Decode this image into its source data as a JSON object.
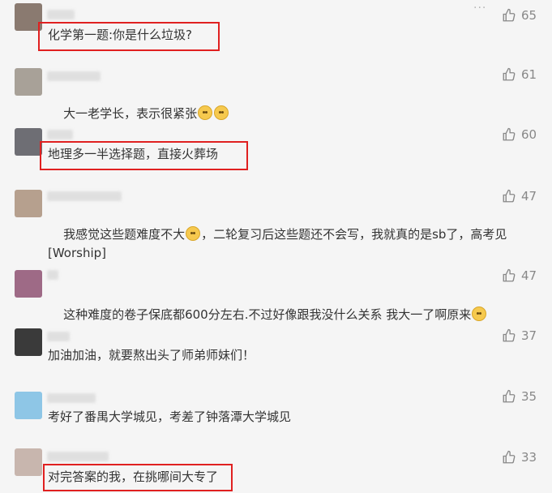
{
  "comments": [
    {
      "text": "化学第一题:你是什么垃圾?",
      "likes": "65",
      "highlighted": true,
      "avatar_color": "#8a7a70"
    },
    {
      "text": "大一老学长，表示很紧张",
      "emoji": "worried-face-icon",
      "emoji_count": 2,
      "likes": "61",
      "highlighted": false,
      "avatar_color": "#a8a198"
    },
    {
      "text": "地理多一半选择题，直接火葬场",
      "likes": "60",
      "highlighted": true,
      "avatar_color": "#6e6e74"
    },
    {
      "text": "我感觉这些题难度不大",
      "emoji": "smile-face-icon",
      "text_after_emoji": "，二轮复习后这些题还不会写，我就真的是sb了，高考见",
      "text_line2": "[Worship]",
      "likes": "47",
      "highlighted": false,
      "avatar_color": "#b6a08e"
    },
    {
      "text": "这种难度的卷子保底都600分左右.不过好像跟我没什么关系 我大一了啊原来",
      "emoji": "grin-face-icon",
      "likes": "47",
      "highlighted": false,
      "avatar_color": "#9e6a86"
    },
    {
      "text": "加油加油，就要熬出头了师弟师妹们！",
      "likes": "37",
      "highlighted": false,
      "avatar_color": "#3a3a3a"
    },
    {
      "text": "考好了番禺大学城见，考差了钟落潭大学城见",
      "likes": "35",
      "highlighted": false,
      "avatar_color": "#8ec6e6"
    },
    {
      "text": "对完答案的我，在挑哪间大专了",
      "likes": "33",
      "highlighted": true,
      "avatar_color": "#c8b6ae"
    }
  ],
  "ui": {
    "more_glyph": "···"
  }
}
